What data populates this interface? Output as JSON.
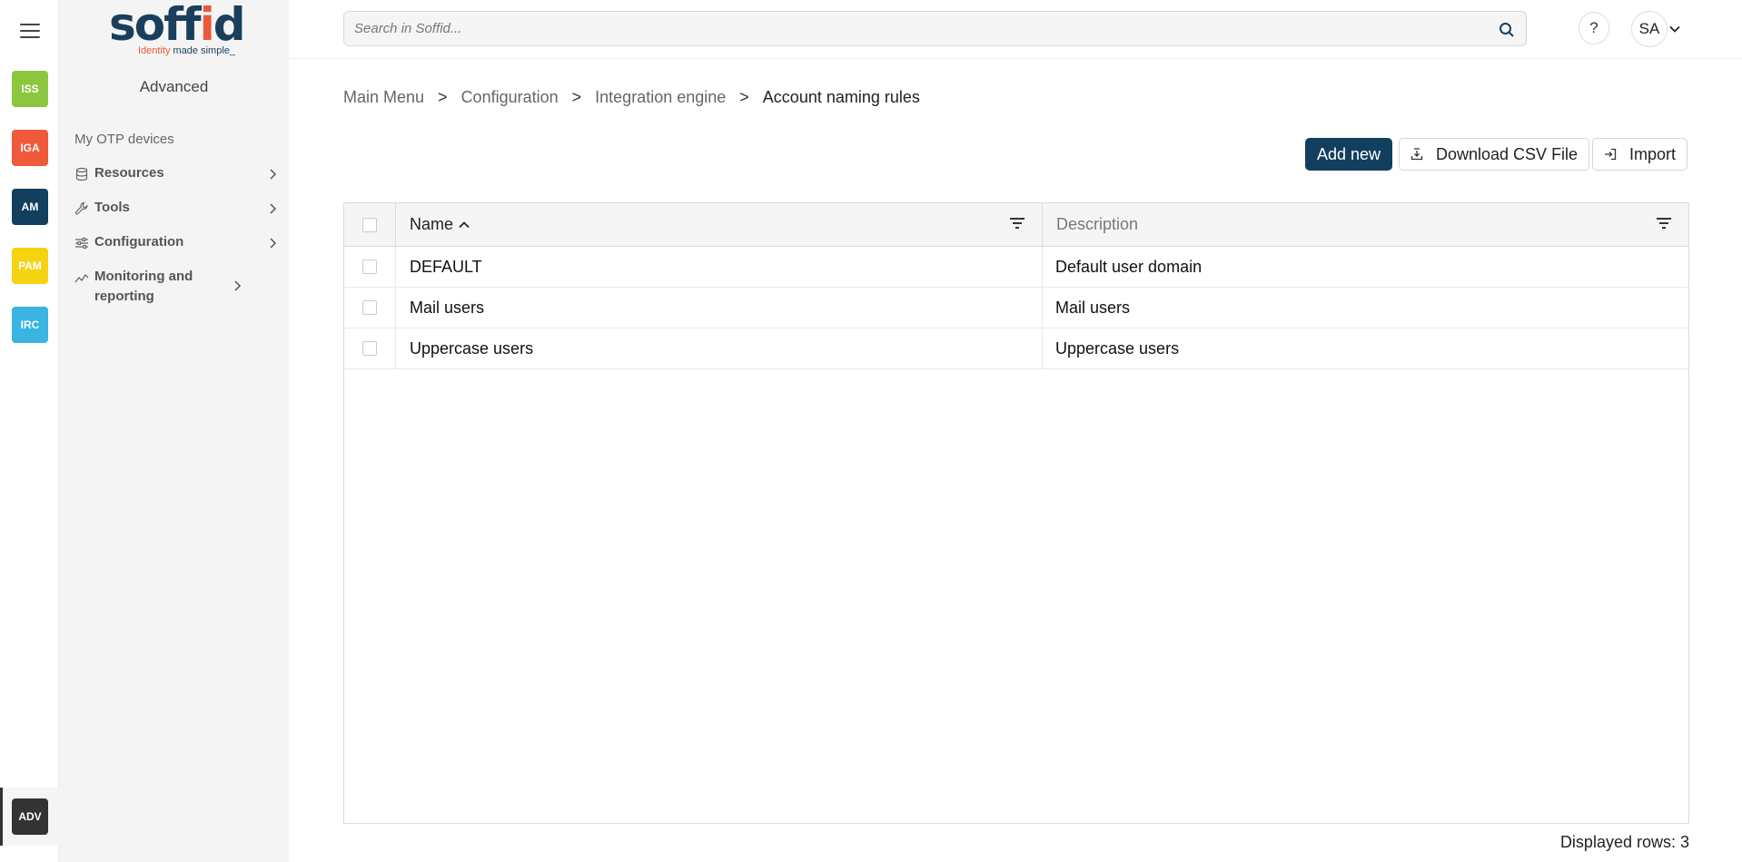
{
  "app": {
    "brand": "soffid",
    "brand_tagline_a": "Identity",
    "brand_tagline_b": "made simple_"
  },
  "rail": {
    "apps": [
      {
        "label": "ISS",
        "color": "#8cc63f"
      },
      {
        "label": "IGA",
        "color": "#f05a3a"
      },
      {
        "label": "AM",
        "color": "#123f5e"
      },
      {
        "label": "PAM",
        "color": "#f5d212"
      },
      {
        "label": "IRC",
        "color": "#3ab4e0"
      }
    ],
    "active_app": {
      "label": "ADV",
      "color": "#333333"
    }
  },
  "sidebar": {
    "title": "Advanced",
    "plain_item": "My OTP devices",
    "items": [
      {
        "label": "Resources",
        "icon": "database-icon"
      },
      {
        "label": "Tools",
        "icon": "wrench-icon"
      },
      {
        "label": "Configuration",
        "icon": "sliders-icon"
      },
      {
        "label": "Monitoring and reporting",
        "icon": "chart-line-icon"
      }
    ]
  },
  "header": {
    "search_placeholder": "Search in Soffid...",
    "help_label": "?",
    "user_initials": "SA"
  },
  "breadcrumb": {
    "items": [
      "Main Menu",
      "Configuration",
      "Integration engine"
    ],
    "separator": ">",
    "current": "Account naming rules"
  },
  "toolbar": {
    "add_label": "Add new",
    "download_label": "Download CSV File",
    "import_label": "Import"
  },
  "table": {
    "columns": [
      "Name",
      "Description"
    ],
    "rows": [
      {
        "name": "DEFAULT",
        "description": "Default user domain"
      },
      {
        "name": "Mail users",
        "description": "Mail users"
      },
      {
        "name": "Uppercase users",
        "description": "Uppercase users"
      }
    ],
    "footer": "Displayed rows: 3"
  }
}
